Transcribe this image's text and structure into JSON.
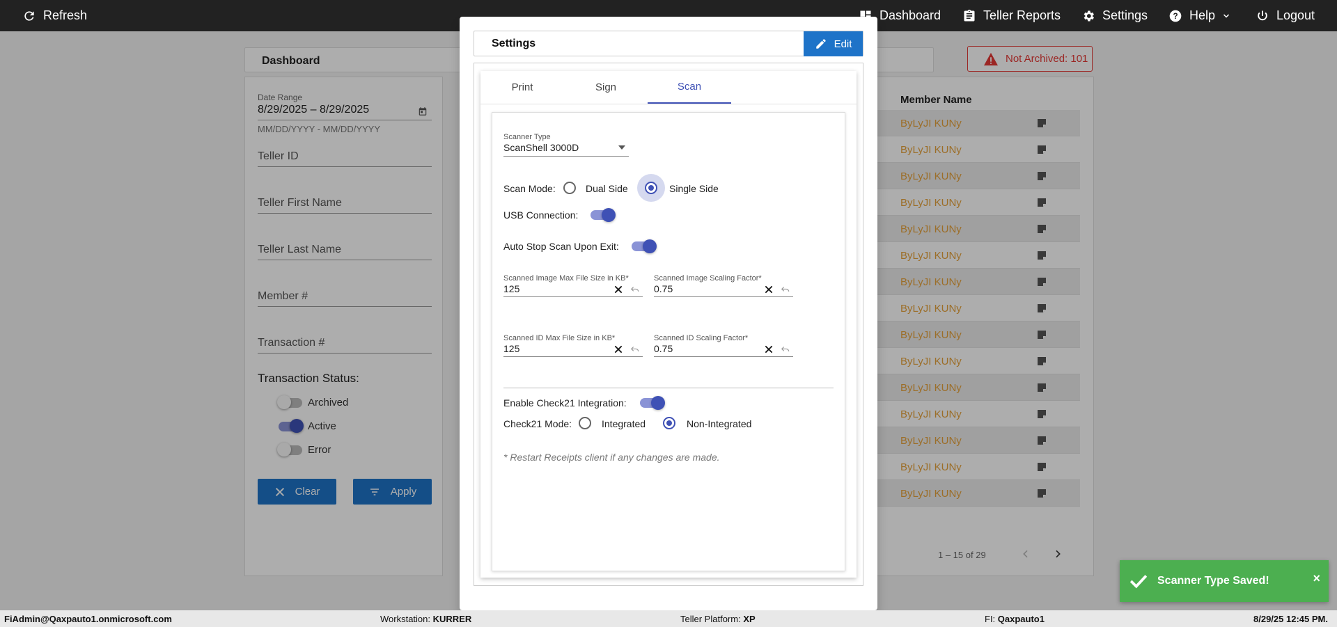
{
  "topbar": {
    "refresh": "Refresh",
    "dashboard": "Dashboard",
    "teller_reports": "Teller Reports",
    "settings": "Settings",
    "help": "Help",
    "logout": "Logout"
  },
  "background": {
    "dashboard_title": "Dashboard",
    "not_archived": "Not Archived: 101",
    "filters": {
      "date_range_label": "Date Range",
      "date_range_value": "8/29/2025 – 8/29/2025",
      "date_hint": "MM/DD/YYYY - MM/DD/YYYY",
      "teller_id": "Teller ID",
      "teller_first_name": "Teller First Name",
      "teller_last_name": "Teller Last Name",
      "member_no": "Member #",
      "transaction_no": "Transaction #",
      "transaction_status": "Transaction Status:",
      "statuses": [
        {
          "label": "Archived",
          "on": false
        },
        {
          "label": "Active",
          "on": true
        },
        {
          "label": "Error",
          "on": false
        }
      ],
      "clear": "Clear",
      "apply": "Apply"
    },
    "table": {
      "member_name_header": "Member Name",
      "rows": [
        "ByLyJI KUNy",
        "ByLyJI KUNy",
        "ByLyJI KUNy",
        "ByLyJI KUNy",
        "ByLyJI KUNy",
        "ByLyJI KUNy",
        "ByLyJI KUNy",
        "ByLyJI KUNy",
        "ByLyJI KUNy",
        "ByLyJI KUNy",
        "ByLyJI KUNy",
        "ByLyJI KUNy",
        "ByLyJI KUNy",
        "ByLyJI KUNy",
        "ByLyJI KUNy"
      ],
      "pagination": "1 – 15 of 29"
    }
  },
  "dialog": {
    "title": "Settings",
    "edit": "Edit",
    "tabs": [
      "Print",
      "Sign",
      "Scan"
    ],
    "active_tab": "Scan",
    "scan": {
      "scanner_type_label": "Scanner Type",
      "scanner_type_value": "ScanShell 3000D",
      "scan_mode_label": "Scan Mode:",
      "scan_mode_dual": "Dual Side",
      "scan_mode_single": "Single Side",
      "usb_connection": "USB Connection:",
      "auto_stop": "Auto Stop Scan Upon Exit:",
      "img_max_label": "Scanned Image Max File Size in KB*",
      "img_max_value": "125",
      "img_scale_label": "Scanned Image Scaling Factor*",
      "img_scale_value": "0.75",
      "id_max_label": "Scanned ID Max File Size in KB*",
      "id_max_value": "125",
      "id_scale_label": "Scanned ID Scaling Factor*",
      "id_scale_value": "0.75",
      "check21_enable": "Enable Check21 Integration:",
      "check21_mode": "Check21 Mode:",
      "check21_integrated": "Integrated",
      "check21_non_integrated": "Non-Integrated",
      "restart_note": "* Restart Receipts client if any changes are made."
    }
  },
  "toast": {
    "message": "Scanner Type Saved!",
    "close": "×"
  },
  "footer": {
    "user": "FiAdmin@Qaxpauto1.onmicrosoft.com",
    "workstation_label": "Workstation:",
    "workstation_value": "KURRER",
    "platform_label": "Teller Platform:",
    "platform_value": "XP",
    "fi_label": "FI:",
    "fi_value": "Qaxpauto1",
    "datetime": "8/29/25 12:45 PM."
  },
  "colors": {
    "accent": "#3f51b5",
    "button_blue": "#1e73c8",
    "member_name": "#e6a23c",
    "alert_red": "#e53935",
    "toast_green": "#4caf50"
  }
}
